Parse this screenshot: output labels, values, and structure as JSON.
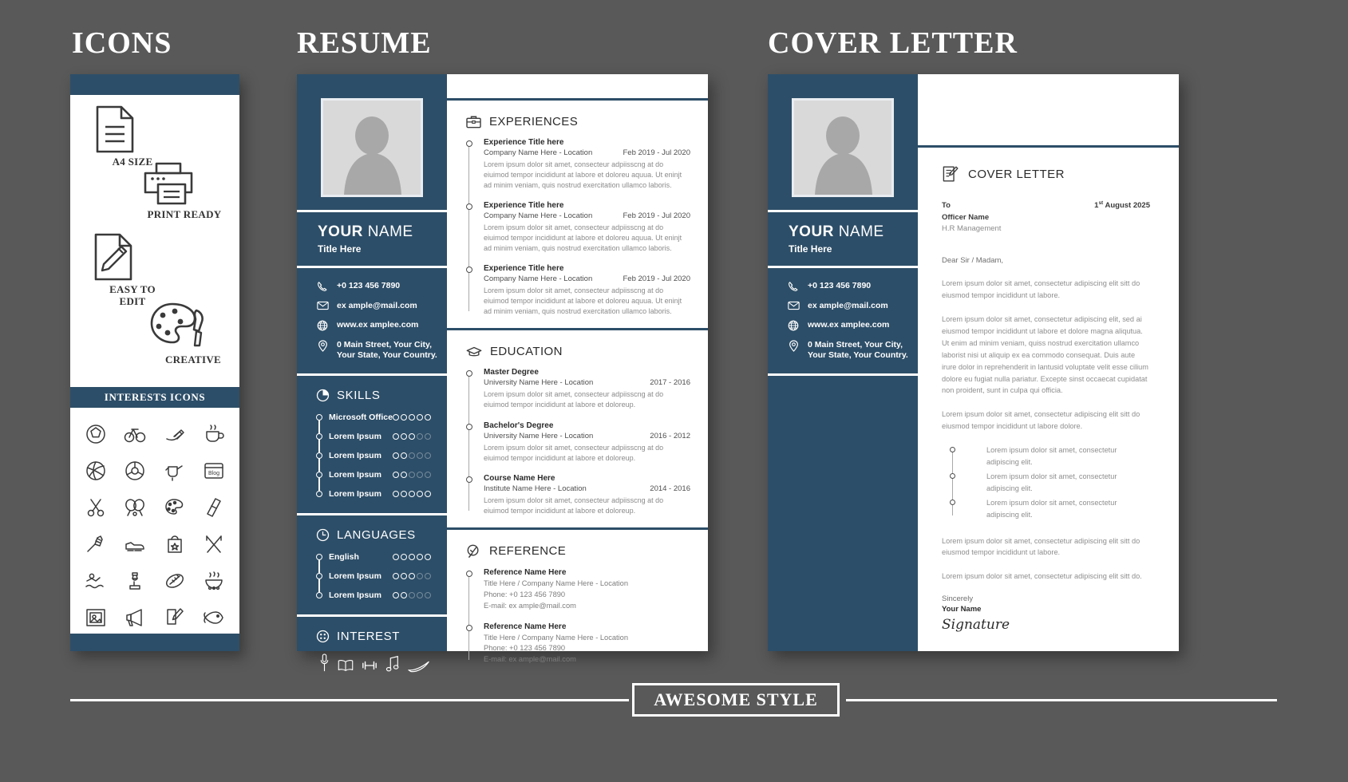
{
  "titles": {
    "icons": "ICONS",
    "resume": "RESUME",
    "cover_letter": "COVER LETTER"
  },
  "footer": {
    "badge": "AWESOME STYLE"
  },
  "colors": {
    "navy": "#2d4e68",
    "background": "#595959",
    "paper": "#ffffff",
    "muted_text": "#8e8e8e"
  },
  "icons_panel": {
    "features": [
      {
        "label": "A4 SIZE",
        "icon": "document-icon"
      },
      {
        "label": "PRINT READY",
        "icon": "printer-icon"
      },
      {
        "label": "EASY TO\nEDIT",
        "label_line1": "EASY TO",
        "label_line2": "EDIT",
        "icon": "pencil-document-icon"
      },
      {
        "label": "CREATIVE",
        "icon": "palette-icon"
      }
    ],
    "interests_bar": "INTERESTS ICONS",
    "interest_icons": [
      "soccer-ball-icon",
      "bicycle-icon",
      "writing-hand-icon",
      "coffee-cup-icon",
      "volleyball-icon",
      "steering-wheel-icon",
      "watering-can-icon",
      "blog-icon",
      "scissors-icon",
      "ping-pong-icon",
      "paint-palette-icon",
      "luggage-icon",
      "badminton-shuttlecock-icon",
      "running-shoe-icon",
      "shopping-bag-icon",
      "fork-knife-icon",
      "swimming-icon",
      "chess-piece-icon",
      "american-football-icon",
      "hot-bowl-icon",
      "photo-frame-icon",
      "megaphone-icon",
      "book-pencil-icon",
      "fish-icon"
    ]
  },
  "person": {
    "name_first": "YOUR",
    "name_last": "NAME",
    "title": "Title Here",
    "contacts": [
      {
        "icon": "phone-icon",
        "value": "+0 123 456 7890"
      },
      {
        "icon": "envelope-icon",
        "value": "ex ample@mail.com"
      },
      {
        "icon": "globe-icon",
        "value": "www.ex amplee.com"
      },
      {
        "icon": "location-pin-icon",
        "line1": "0 Main Street, Your City,",
        "line2": "Your State, Your Country."
      }
    ]
  },
  "resume": {
    "skills": {
      "heading": "SKILLS",
      "icon": "pie-chart-icon",
      "max_rating": 5,
      "items": [
        {
          "label": "Microsoft Office",
          "rating": 5
        },
        {
          "label": "Lorem Ipsum",
          "rating": 3
        },
        {
          "label": "Lorem Ipsum",
          "rating": 2
        },
        {
          "label": "Lorem Ipsum",
          "rating": 2
        },
        {
          "label": "Lorem Ipsum",
          "rating": 5
        }
      ]
    },
    "languages": {
      "heading": "LANGUAGES",
      "icon": "clock-icon",
      "max_rating": 5,
      "items": [
        {
          "label": "English",
          "rating": 5
        },
        {
          "label": "Lorem Ipsum",
          "rating": 3
        },
        {
          "label": "Lorem Ipsum",
          "rating": 2
        }
      ]
    },
    "interest": {
      "heading": "INTEREST",
      "icon": "dice-icon",
      "items": [
        "microphone-icon",
        "book-icon",
        "dumbbell-icon",
        "music-note-icon",
        "swoosh-icon"
      ]
    },
    "experiences": {
      "heading": "EXPERIENCES",
      "icon": "briefcase-icon",
      "items": [
        {
          "title": "Experience Title here",
          "subtitle": "Company Name Here - Location",
          "dates": "Feb 2019 - Jul 2020",
          "desc": "Lorem ipsum dolor sit amet, consecteur adpiisscng at do eiuimod tempor incididunt at labore et doloreu aquua. Ut eninjt ad minim veniam, quis nostrud exercitation ullamco laboris."
        },
        {
          "title": "Experience Title here",
          "subtitle": "Company Name Here - Location",
          "dates": "Feb 2019 - Jul 2020",
          "desc": "Lorem ipsum dolor sit amet, consecteur adpiisscng at do eiuimod tempor incididunt at labore et doloreu aquua. Ut eninjt ad minim veniam, quis nostrud exercitation ullamco laboris."
        },
        {
          "title": "Experience Title here",
          "subtitle": "Company Name Here - Location",
          "dates": "Feb 2019 - Jul 2020",
          "desc": "Lorem ipsum dolor sit amet, consecteur adpiisscng at do eiuimod tempor incididunt at labore et doloreu aquua. Ut eninjt ad minim veniam, quis nostrud exercitation ullamco laboris."
        }
      ]
    },
    "education": {
      "heading": "EDUCATION",
      "icon": "graduation-cap-icon",
      "items": [
        {
          "title": "Master Degree",
          "subtitle": "University Name Here - Location",
          "dates": "2017 - 2016",
          "desc": "Lorem ipsum dolor sit amet, consecteur adpiisscng at do eiuimod tempor incididunt at labore et doloreup."
        },
        {
          "title": "Bachelor's Degree",
          "subtitle": "University Name Here - Location",
          "dates": "2016 - 2012",
          "desc": "Lorem ipsum dolor sit amet, consecteur adpiisscng at do eiuimod tempor incididunt at labore et doloreup."
        },
        {
          "title": "Course Name Here",
          "subtitle": "Institute Name Here - Location",
          "dates": "2014 - 2016",
          "desc": "Lorem ipsum dolor sit amet, consecteur adpiisscng at do eiuimod tempor incididunt at labore et doloreup."
        }
      ]
    },
    "reference": {
      "heading": "REFERENCE",
      "icon": "check-magnifier-icon",
      "items": [
        {
          "title": "Reference Name Here",
          "line1": "Title Here / Company Name Here - Location",
          "line2": "Phone: +0 123 456 7890",
          "line3": "E-mail: ex ample@mail.com"
        },
        {
          "title": "Reference Name Here",
          "line1": "Title Here / Company Name Here - Location",
          "line2": "Phone: +0 123 456 7890",
          "line3": "E-mail: ex ample@mail.com"
        }
      ]
    }
  },
  "cover_letter": {
    "heading": "COVER LETTER",
    "icon": "letter-pencil-icon",
    "to_label": "To",
    "officer_name": "Officer Name",
    "department": "H.R Management",
    "date_day": "1",
    "date_sup": "st",
    "date_rest": " August 2025",
    "date_full": "1st August 2025",
    "greeting": "Dear Sir / Madam,",
    "paragraphs": [
      "Lorem ipsum dolor sit amet, consectetur adipiscing elit sitt do eiusmod tempor incididunt ut labore.",
      "Lorem ipsum dolor sit amet, consectetur adipiscing elit, sed ai eiusmod tempor incididunt ut labore et dolore magna aliqutua. Ut enim ad minim veniam, quiss nostrud exercitation ullamco laborist nisi ut aliquip ex ea commodo consequat. Duis aute irure dolor in reprehenderit in lantusid voluptate velit esse cilium dolore eu fugiat nulla pariatur. Excepte sinst occaecat cupidatat non proident, sunt in culpa qui officia.",
      "Lorem ipsum dolor sit amet, consectetur adipiscing elit sitt do eiusmod tempor incididunt ut labore dolore."
    ],
    "bullets": [
      "Lorem ipsum dolor sit amet, consectetur adipiscing elit.",
      "Lorem ipsum dolor sit amet, consectetur adipiscing elit.",
      "Lorem ipsum dolor sit amet, consectetur adipiscing elit."
    ],
    "paragraphs_after": [
      "Lorem ipsum dolor sit amet, consectetur adipiscing elit sitt do eiusmod tempor incididunt ut labore.",
      "Lorem ipsum dolor sit amet, consectetur adipiscing elit sitt do."
    ],
    "sincerely": "Sincerely",
    "your_name": "Your Name",
    "signature": "Signature"
  }
}
